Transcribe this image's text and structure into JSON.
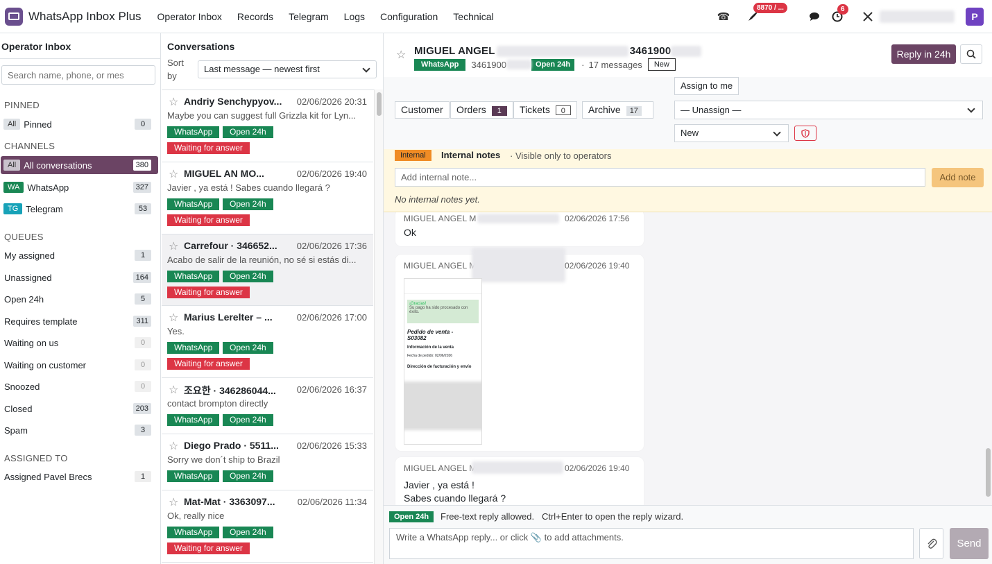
{
  "app": {
    "title": "WhatsApp Inbox Plus",
    "avatar_letter": "P"
  },
  "menu": [
    "Operator Inbox",
    "Records",
    "Telegram",
    "Logs",
    "Configuration",
    "Technical"
  ],
  "topbar": {
    "rocket_badge": "8870 / ...",
    "activity_badge": "6"
  },
  "left": {
    "title": "Operator Inbox",
    "search_placeholder": "Search name, phone, or mes",
    "pinned_header": "PINNED",
    "pinned": {
      "tag": "All",
      "label": "Pinned",
      "count": "0"
    },
    "channels_header": "CHANNELS",
    "channels": [
      {
        "tag": "All",
        "label": "All conversations",
        "count": "380"
      },
      {
        "tag": "WA",
        "label": "WhatsApp",
        "count": "327"
      },
      {
        "tag": "TG",
        "label": "Telegram",
        "count": "53"
      }
    ],
    "queues_header": "QUEUES",
    "queues": [
      {
        "label": "My assigned",
        "count": "1"
      },
      {
        "label": "Unassigned",
        "count": "164"
      },
      {
        "label": "Open 24h",
        "count": "5"
      },
      {
        "label": "Requires template",
        "count": "311"
      },
      {
        "label": "Waiting on us",
        "count": "0"
      },
      {
        "label": "Waiting on customer",
        "count": "0"
      },
      {
        "label": "Snoozed",
        "count": "0"
      },
      {
        "label": "Closed",
        "count": "203"
      },
      {
        "label": "Spam",
        "count": "3"
      }
    ],
    "assigned_header": "ASSIGNED TO",
    "assigned": [
      {
        "label": "Assigned Pavel Brecs",
        "count": "1"
      }
    ]
  },
  "middle": {
    "title": "Conversations",
    "sort_label": "Sort by",
    "sort_value": "Last message — newest first",
    "conversations": [
      {
        "name": "Andriy Senchypyov...",
        "date": "02/06/2026 20:31",
        "preview": "Maybe you can suggest full Grizzla kit for Lyn...",
        "tags": [
          "WhatsApp",
          "Open 24h"
        ],
        "status": "Waiting for answer"
      },
      {
        "name": "MIGUEL AN        MO...",
        "date": "02/06/2026 19:40",
        "preview": "Javier , ya está ! Sabes cuando llegará ?",
        "tags": [
          "WhatsApp",
          "Open 24h"
        ],
        "status": "Waiting for answer"
      },
      {
        "name": "Carrefour · 346652...",
        "date": "02/06/2026 17:36",
        "preview": "Acabo de salir de la reunión, no sé si estás di...",
        "tags": [
          "WhatsApp",
          "Open 24h"
        ],
        "status": "Waiting for answer"
      },
      {
        "name": "Marius Lerelter – ...",
        "date": "02/06/2026 17:00",
        "preview": "Yes.",
        "tags": [
          "WhatsApp",
          "Open 24h"
        ],
        "status": "Waiting for answer"
      },
      {
        "name": "조요한 · 346286044...",
        "date": "02/06/2026 16:37",
        "preview": "contact brompton directly",
        "tags": [
          "WhatsApp",
          "Open 24h"
        ],
        "status": ""
      },
      {
        "name": "Diego Prado · 5511...",
        "date": "02/06/2026 15:33",
        "preview": "Sorry we don´t ship to Brazil",
        "tags": [
          "WhatsApp",
          "Open 24h"
        ],
        "status": ""
      },
      {
        "name": "Mat-Mat · 3363097...",
        "date": "02/06/2026 11:34",
        "preview": "Ok, really nice",
        "tags": [
          "WhatsApp",
          "Open 24h"
        ],
        "status": "Waiting for answer"
      }
    ]
  },
  "detail": {
    "name": "MIGUEL ANGEL",
    "name_suffix": "3461900",
    "channel": "WhatsApp",
    "phone": "3461900",
    "window": "Open 24h",
    "messages_count": "17 messages",
    "state_badge": "New",
    "reply_button": "Reply in 24h",
    "tabs": [
      {
        "label": "Customer",
        "count": ""
      },
      {
        "label": "Orders",
        "count": "1"
      },
      {
        "label": "Tickets",
        "count": "0"
      },
      {
        "label": "Archive",
        "count": "17"
      }
    ],
    "assign_button": "Assign to me",
    "assignee_select": "— Unassign —",
    "status_select": "New",
    "notes": {
      "tag": "Internal",
      "title": "Internal notes",
      "subtitle": "Visible only to operators",
      "placeholder": "Add internal note...",
      "add_button": "Add note",
      "empty": "No internal notes yet."
    },
    "messages": [
      {
        "who": "MIGUEL ANGEL M",
        "when": "02/06/2026 17:56",
        "text": "Ok"
      },
      {
        "who": "MIGUEL ANGEL M",
        "when": "02/06/2026 19:40",
        "text": ""
      },
      {
        "who": "MIGUEL ANGEL M",
        "when": "02/06/2026 19:40",
        "text_line1": "Javier , ya está !",
        "text_line2": "Sabes cuando llegará ?"
      }
    ],
    "attachment": {
      "heading": "¡Gracias!",
      "sub": "Su pago ha sido procesado con éxito.",
      "order_title": "Pedido de venta -",
      "order_no": "S03082",
      "info": "Información de la venta",
      "date_label": "Fecha de pedido: 02/06/2026",
      "billing": "Dirección de facturación y envío"
    },
    "composer": {
      "badge": "Open 24h",
      "hint": "Free-text reply allowed.   Ctrl+Enter to open the reply wizard.",
      "placeholder": "Write a WhatsApp reply... or click 📎 to add attachments.",
      "send": "Send"
    }
  }
}
